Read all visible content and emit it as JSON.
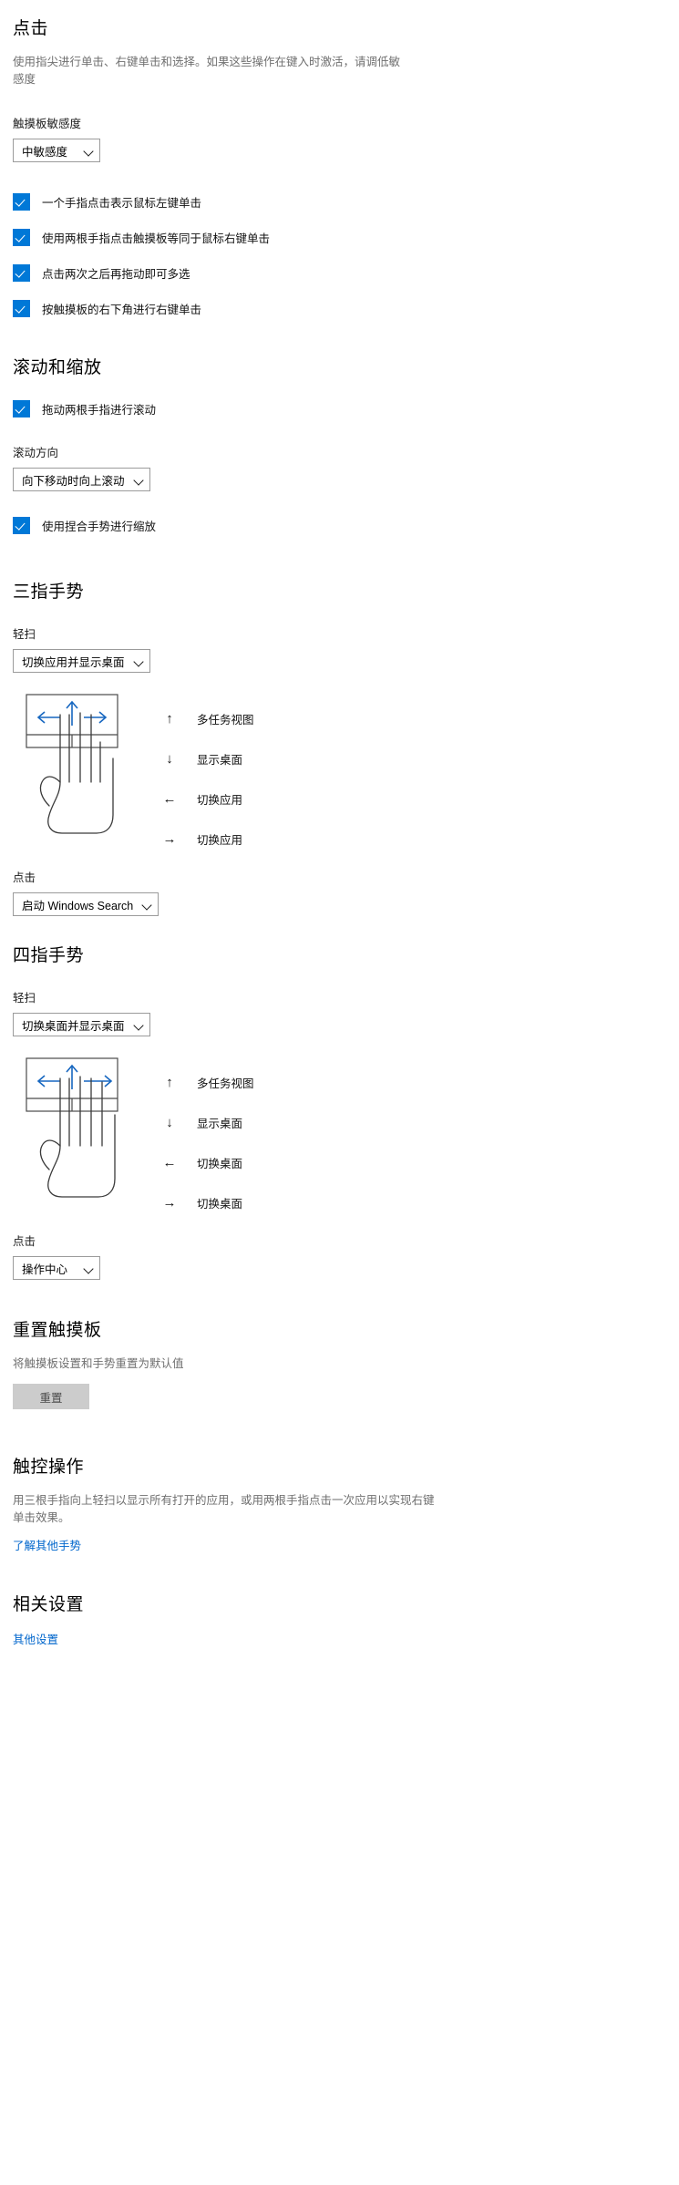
{
  "click_section": {
    "heading": "点击",
    "description": "使用指尖进行单击、右键单击和选择。如果这些操作在键入时激活，请调低敏感度",
    "sensitivity_label": "触摸板敏感度",
    "sensitivity_value": "中敏感度",
    "checkboxes": [
      {
        "label": "一个手指点击表示鼠标左键单击",
        "checked": true
      },
      {
        "label": "使用两根手指点击触摸板等同于鼠标右键单击",
        "checked": true
      },
      {
        "label": "点击两次之后再拖动即可多选",
        "checked": true
      },
      {
        "label": "按触摸板的右下角进行右键单击",
        "checked": true
      }
    ]
  },
  "scroll_section": {
    "heading": "滚动和缩放",
    "two_finger_scroll": {
      "label": "拖动两根手指进行滚动",
      "checked": true
    },
    "direction_label": "滚动方向",
    "direction_value": "向下移动时向上滚动",
    "pinch_zoom": {
      "label": "使用捏合手势进行缩放",
      "checked": true
    }
  },
  "three_finger_section": {
    "heading": "三指手势",
    "swipe_label": "轻扫",
    "swipe_value": "切换应用并显示桌面",
    "legend": [
      {
        "arrow": "↑",
        "text": "多任务视图"
      },
      {
        "arrow": "↓",
        "text": "显示桌面"
      },
      {
        "arrow": "←",
        "text": "切换应用"
      },
      {
        "arrow": "→",
        "text": "切换应用"
      }
    ],
    "tap_label": "点击",
    "tap_value": "启动 Windows Search"
  },
  "four_finger_section": {
    "heading": "四指手势",
    "swipe_label": "轻扫",
    "swipe_value": "切换桌面并显示桌面",
    "legend": [
      {
        "arrow": "↑",
        "text": "多任务视图"
      },
      {
        "arrow": "↓",
        "text": "显示桌面"
      },
      {
        "arrow": "←",
        "text": "切换桌面"
      },
      {
        "arrow": "→",
        "text": "切换桌面"
      }
    ],
    "tap_label": "点击",
    "tap_value": "操作中心"
  },
  "reset_section": {
    "heading": "重置触摸板",
    "description": "将触摸板设置和手势重置为默认值",
    "button_label": "重置"
  },
  "touch_section": {
    "heading": "触控操作",
    "description": "用三根手指向上轻扫以显示所有打开的应用，或用两根手指点击一次应用以实现右键单击效果。",
    "link_label": "了解其他手势"
  },
  "related_section": {
    "heading": "相关设置",
    "link_label": "其他设置"
  },
  "colors": {
    "accent": "#0078d7",
    "link": "#0066cc",
    "muted_text": "#6f6f6f",
    "combo_border": "#9b9b9b"
  }
}
